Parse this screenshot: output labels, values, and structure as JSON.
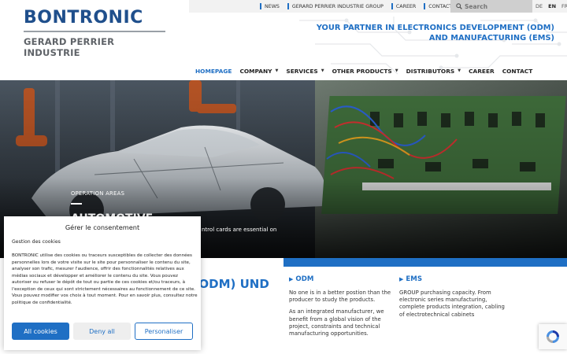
{
  "brand": {
    "name": "BONTRONIC",
    "subtitle": "GERARD PERRIER INDUSTRIE"
  },
  "topbar": {
    "links": [
      "NEWS",
      "GERARD PERRIER INDUSTRIE GROUP",
      "CAREER",
      "CONTACT"
    ],
    "search_placeholder": "Search",
    "languages": [
      "DE",
      "EN",
      "FR"
    ],
    "active_language": "EN"
  },
  "tagline": {
    "line1": "YOUR PARTNER IN ELECTRONICS DEVELOPMENT (ODM)",
    "line2": "AND MANUFACTURING (EMS)"
  },
  "nav": {
    "items": [
      {
        "label": "HOMEPAGE",
        "dropdown": false,
        "active": true
      },
      {
        "label": "COMPANY",
        "dropdown": true,
        "active": false
      },
      {
        "label": "SERVICES",
        "dropdown": true,
        "active": false
      },
      {
        "label": "OTHER PRODUCTS",
        "dropdown": true,
        "active": false
      },
      {
        "label": "DISTRIBUTORS",
        "dropdown": true,
        "active": false
      },
      {
        "label": "CAREER",
        "dropdown": false,
        "active": false
      },
      {
        "label": "CONTACT",
        "dropdown": false,
        "active": false
      }
    ]
  },
  "hero": {
    "overline": "OPERATION AREAS",
    "title": "AUTOMOTIVE",
    "text": "ntrol cards are essential on"
  },
  "intro": {
    "title_fragment": "G (ODM) UND"
  },
  "columns": [
    {
      "heading": "ODM",
      "paragraphs": [
        "No one is in a better postion than the producer to study the products.",
        "As an integrated manufacturer, we benefit from a global vision of the project, constraints and technical manufacturing opportunities."
      ]
    },
    {
      "heading": "EMS",
      "paragraphs": [
        "GROUP purchasing capacity. From electronic series manufacturing, complete products integration, cabling of electrotechnical cabinets"
      ]
    }
  ],
  "cookie": {
    "title": "Gérer le consentement",
    "subtitle": "Gestion des cookies",
    "body": "BONTRONIC utilise des cookies ou traceurs susceptibles de collecter des données personnelles lors de votre visite sur le site pour personnaliser le contenu du site, analyser son trafic, mesurer l'audience, offrir des fonctionnalités relatives aux médias sociaux et développer et améliorer le contenu du site. Vous pouvez autoriser ou refuser le dépôt de tout ou partie de ces cookies et/ou traceurs, à l'exception de ceux qui sont strictement nécessaires au fonctionnement de ce site. Vous pouvez modifier vos choix à tout moment. Pour en savoir plus, consultez notre politique de confidentialité.",
    "btn_all": "All cookies",
    "btn_deny": "Deny all",
    "btn_custom": "Personaliser"
  },
  "colors": {
    "brand_blue": "#1f4f8c",
    "accent_blue": "#1f6fc4",
    "grey": "#5f6368"
  }
}
